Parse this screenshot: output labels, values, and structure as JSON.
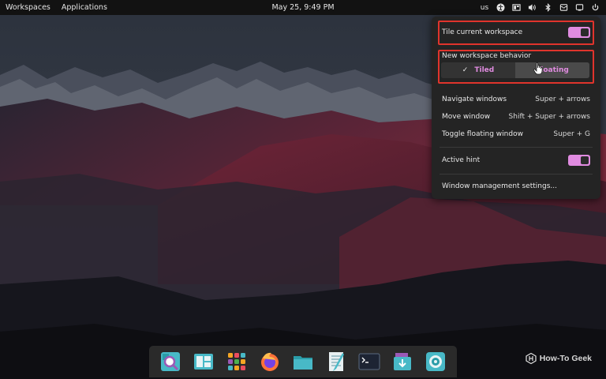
{
  "top_panel": {
    "workspaces_label": "Workspaces",
    "applications_label": "Applications",
    "clock": "May 25, 9:49 PM",
    "keyboard_layout": "us",
    "tray_icons": [
      "accessibility-icon",
      "tiling-icon",
      "volume-icon",
      "bluetooth-icon",
      "notifications-icon",
      "network-icon",
      "power-icon"
    ]
  },
  "menu": {
    "tile_current_workspace": "Tile current workspace",
    "tile_current_workspace_on": true,
    "new_workspace_behavior": "New workspace behavior",
    "behavior_options": [
      {
        "label": "Tiled",
        "selected": true,
        "check": "✓"
      },
      {
        "label": "Floating",
        "selected": false
      }
    ],
    "shortcuts": [
      {
        "label": "Navigate windows",
        "keys": "Super + arrows"
      },
      {
        "label": "Move window",
        "keys": "Shift + Super + arrows"
      },
      {
        "label": "Toggle floating window",
        "keys": "Super + G"
      }
    ],
    "active_hint": "Active hint",
    "active_hint_on": true,
    "settings_link": "Window management settings..."
  },
  "dock": {
    "apps": [
      "launcher-icon",
      "workspaces-icon",
      "app-grid-icon",
      "firefox-icon",
      "files-icon",
      "text-editor-icon",
      "terminal-icon",
      "pop-shop-icon",
      "settings-icon"
    ]
  },
  "watermark": {
    "text": "How-To Geek"
  },
  "colors": {
    "accent": "#e08be0",
    "highlight": "#e0342c",
    "panel_bg": "#121212",
    "menu_bg": "#242424"
  }
}
